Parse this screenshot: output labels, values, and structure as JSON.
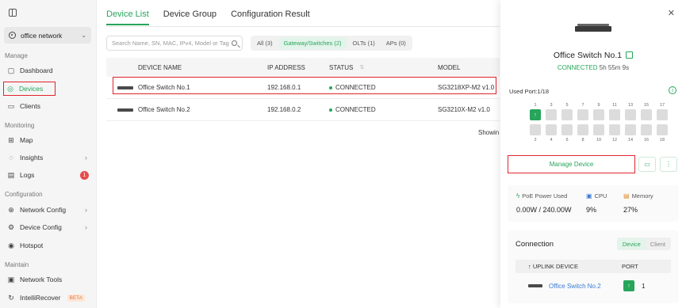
{
  "sidebar": {
    "site": "office network",
    "groups": {
      "manage": "Manage",
      "monitoring": "Monitoring",
      "configuration": "Configuration",
      "maintain": "Maintain"
    },
    "items": {
      "dashboard": "Dashboard",
      "devices": "Devices",
      "clients": "Clients",
      "map": "Map",
      "insights": "Insights",
      "logs": "Logs",
      "logs_badge": "1",
      "network_config": "Network Config",
      "device_config": "Device Config",
      "hotspot": "Hotspot",
      "network_tools": "Network Tools",
      "intellirecover": "IntelliRecover",
      "beta": "BETA"
    }
  },
  "main": {
    "tabs": [
      "Device List",
      "Device Group",
      "Configuration Result"
    ],
    "search_placeholder": "Search Name, SN, MAC, IPv4, Model or Tag",
    "filters": [
      "All (3)",
      "Gateway/Switches (2)",
      "OLTs (1)",
      "APs (0)"
    ],
    "columns": {
      "name": "DEVICE NAME",
      "ip": "IP ADDRESS",
      "status": "STATUS",
      "model": "MODEL"
    },
    "rows": [
      {
        "name": "Office Switch No.1",
        "ip": "192.168.0.1",
        "status": "CONNECTED",
        "model": "SG3218XP-M2 v1.0"
      },
      {
        "name": "Office Switch No.2",
        "ip": "192.168.0.2",
        "status": "CONNECTED",
        "model": "SG3210X-M2 v1.0"
      }
    ],
    "showing": "Showin"
  },
  "panel": {
    "device_name": "Office Switch No.1",
    "status": "CONNECTED",
    "uptime": "5h 55m 9s",
    "used_port": "Used Port:1/18",
    "port_top": [
      "1",
      "3",
      "5",
      "7",
      "9",
      "11",
      "13",
      "15",
      "17"
    ],
    "port_bottom": [
      "2",
      "4",
      "6",
      "8",
      "10",
      "12",
      "14",
      "16",
      "18"
    ],
    "manage_button": "Manage Device",
    "stats": {
      "poe_label": "PoE Power Used",
      "poe_value": "0.00W / 240.00W",
      "cpu_label": "CPU",
      "cpu_value": "9%",
      "mem_label": "Memory",
      "mem_value": "27%"
    },
    "connection": {
      "title": "Connection",
      "seg": [
        "Device",
        "Client"
      ],
      "uplink_header": "UPLINK DEVICE",
      "port_header": "PORT",
      "uplink_device": "Office Switch No.2",
      "port": "1"
    }
  },
  "colors": {
    "accent": "#27a55b",
    "highlight": "#e0242e",
    "link": "#3b7bd6"
  }
}
